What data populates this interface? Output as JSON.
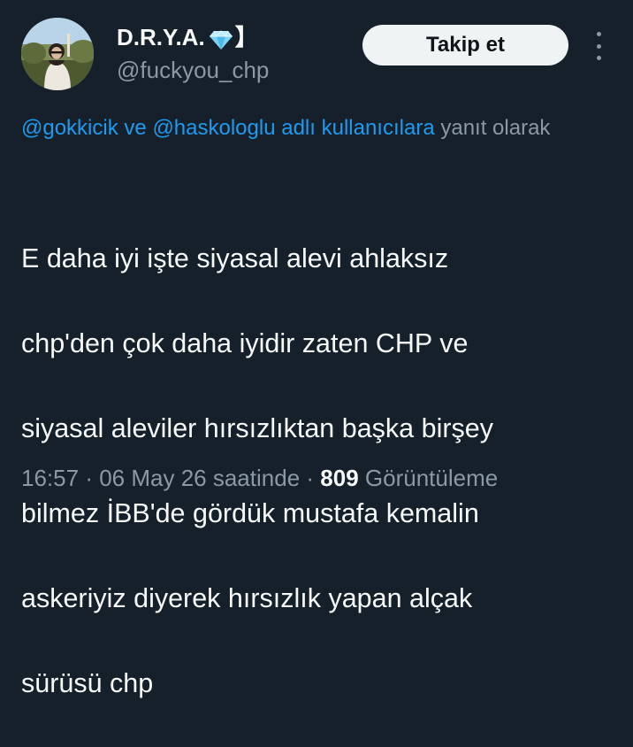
{
  "user": {
    "display_name": "D.R.Y.A.",
    "name_suffix": "】",
    "handle": "@fuckyou_chp",
    "avatar_icon": "profile-photo-avatar",
    "badge_icon": "gem-icon"
  },
  "actions": {
    "follow_label": "Takip et",
    "more_icon": "more-vertical-icon"
  },
  "reply_context": {
    "mention_1": "@gokkicik",
    "connector": "ve",
    "mention_2": "@haskologlu",
    "mention_suffix": "adlı kullanıcılara",
    "trailing": "yanıt olarak"
  },
  "tweet": {
    "lines": [
      "E daha iyi işte siyasal alevi ahlaksız",
      "chp'den çok daha iyidir zaten CHP ve",
      "siyasal aleviler hırsızlıktan başka birşey",
      "bilmez İBB'de gördük mustafa kemalin",
      "askeriyiz diyerek hırsızlık yapan alçak",
      "sürüsü chp"
    ]
  },
  "meta": {
    "time": "16:57",
    "separator": "·",
    "date_text": "06 May 26 saatinde",
    "views_count": "809",
    "views_label": "Görüntüleme"
  },
  "colors": {
    "background": "#15202b",
    "text_primary": "#f7f9f9",
    "text_secondary": "#8b98a5",
    "link": "#1d9bf0",
    "button_bg": "#eff3f4",
    "button_text": "#0f1419"
  }
}
